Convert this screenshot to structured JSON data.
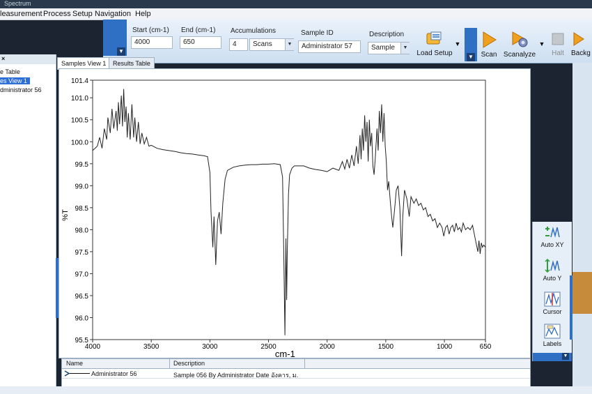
{
  "window": {
    "title": "Spectrum"
  },
  "menu": [
    "leasurement",
    "Process",
    "Setup",
    "Navigation",
    "Help"
  ],
  "toolbar": {
    "start": {
      "label": "Start (cm-1)",
      "value": "4000"
    },
    "end": {
      "label": "End (cm-1)",
      "value": "650"
    },
    "accumulations": {
      "label": "Accumulations",
      "value": "4",
      "unit": "Scans"
    },
    "sample_id": {
      "label": "Sample ID",
      "value": "Administrator 57"
    },
    "description": {
      "label": "Description",
      "value": "Sample"
    },
    "buttons": {
      "load_setup": "Load Setup",
      "scan": "Scan",
      "scanalyze": "Scanalyze",
      "halt": "Halt",
      "background": "Backg"
    }
  },
  "left_panel": {
    "items": [
      {
        "label": "e Table",
        "selected": false
      },
      {
        "label": "es View 1",
        "selected": true
      },
      {
        "label": "dministrator 56",
        "selected": false
      }
    ]
  },
  "tabs": [
    {
      "label": "Samples View 1",
      "active": true
    },
    {
      "label": "Results Table",
      "active": false
    }
  ],
  "right_panel": {
    "buttons": [
      "Auto XY",
      "Auto Y",
      "Cursor",
      "Labels"
    ]
  },
  "results_table": {
    "columns": [
      "Name",
      "Description"
    ],
    "rows": [
      {
        "name": "Administrator 56",
        "description": "Sample 056 By Administrator Date อังคาร, ม."
      }
    ]
  },
  "colors": {
    "accent": "#2f6fc4",
    "scan": "#f0a020",
    "trace": "#222222"
  },
  "chart_data": {
    "type": "line",
    "xlabel": "cm-1",
    "ylabel": "%T",
    "xlim": [
      4000,
      650
    ],
    "ylim": [
      95.5,
      101.4
    ],
    "x_reversed": true,
    "xticks": [
      4000,
      3500,
      3000,
      2500,
      2000,
      1500,
      1000,
      650
    ],
    "yticks": [
      95.5,
      96.0,
      96.5,
      97.0,
      97.5,
      98.0,
      98.5,
      99.0,
      99.5,
      100.0,
      100.5,
      101.0,
      101.4
    ],
    "ytick_labels": [
      "95.5",
      "96.0",
      "96.5",
      "97.0",
      "97.5",
      "98.0",
      "98.5",
      "99.0",
      "99.5",
      "100.0",
      "100.5",
      "101.0",
      "101.4"
    ],
    "series": [
      {
        "values_xy": [
          [
            4000,
            99.8
          ],
          [
            3960,
            99.9
          ],
          [
            3940,
            100.1
          ],
          [
            3920,
            99.85
          ],
          [
            3900,
            100.3
          ],
          [
            3880,
            100.05
          ],
          [
            3870,
            100.55
          ],
          [
            3850,
            100.2
          ],
          [
            3835,
            100.75
          ],
          [
            3820,
            100.3
          ],
          [
            3800,
            100.7
          ],
          [
            3790,
            100.25
          ],
          [
            3780,
            100.9
          ],
          [
            3770,
            100.4
          ],
          [
            3755,
            101.05
          ],
          [
            3745,
            100.35
          ],
          [
            3735,
            101.2
          ],
          [
            3725,
            100.45
          ],
          [
            3715,
            100.8
          ],
          [
            3705,
            100.1
          ],
          [
            3695,
            100.65
          ],
          [
            3680,
            100.05
          ],
          [
            3665,
            100.85
          ],
          [
            3650,
            100.1
          ],
          [
            3640,
            100.55
          ],
          [
            3625,
            100.0
          ],
          [
            3610,
            100.45
          ],
          [
            3595,
            99.95
          ],
          [
            3580,
            100.2
          ],
          [
            3560,
            99.95
          ],
          [
            3540,
            100.1
          ],
          [
            3520,
            99.9
          ],
          [
            3500,
            99.92
          ],
          [
            3450,
            99.85
          ],
          [
            3400,
            99.82
          ],
          [
            3350,
            99.8
          ],
          [
            3300,
            99.78
          ],
          [
            3250,
            99.75
          ],
          [
            3200,
            99.73
          ],
          [
            3150,
            99.72
          ],
          [
            3100,
            99.7
          ],
          [
            3050,
            99.68
          ],
          [
            3020,
            99.66
          ],
          [
            3000,
            99.3
          ],
          [
            2990,
            98.4
          ],
          [
            2975,
            97.6
          ],
          [
            2965,
            98.3
          ],
          [
            2950,
            97.2
          ],
          [
            2935,
            98.2
          ],
          [
            2920,
            98.4
          ],
          [
            2905,
            97.9
          ],
          [
            2890,
            98.6
          ],
          [
            2870,
            99.15
          ],
          [
            2850,
            99.35
          ],
          [
            2800,
            99.42
          ],
          [
            2750,
            99.45
          ],
          [
            2700,
            99.47
          ],
          [
            2650,
            99.48
          ],
          [
            2600,
            99.48
          ],
          [
            2550,
            99.49
          ],
          [
            2500,
            99.49
          ],
          [
            2450,
            99.5
          ],
          [
            2400,
            99.48
          ],
          [
            2380,
            99.2
          ],
          [
            2370,
            97.5
          ],
          [
            2360,
            95.6
          ],
          [
            2352,
            97.8
          ],
          [
            2345,
            96.4
          ],
          [
            2340,
            97.5
          ],
          [
            2330,
            98.8
          ],
          [
            2320,
            99.25
          ],
          [
            2300,
            99.4
          ],
          [
            2280,
            99.45
          ],
          [
            2200,
            99.45
          ],
          [
            2150,
            99.4
          ],
          [
            2100,
            99.37
          ],
          [
            2050,
            99.35
          ],
          [
            2000,
            99.32
          ],
          [
            1950,
            99.4
          ],
          [
            1900,
            99.35
          ],
          [
            1870,
            99.55
          ],
          [
            1850,
            99.38
          ],
          [
            1830,
            99.6
          ],
          [
            1810,
            99.4
          ],
          [
            1790,
            99.7
          ],
          [
            1770,
            99.45
          ],
          [
            1750,
            99.9
          ],
          [
            1735,
            99.5
          ],
          [
            1720,
            100.15
          ],
          [
            1710,
            99.6
          ],
          [
            1700,
            100.3
          ],
          [
            1690,
            99.8
          ],
          [
            1680,
            100.6
          ],
          [
            1670,
            100.0
          ],
          [
            1660,
            100.45
          ],
          [
            1650,
            99.55
          ],
          [
            1640,
            100.5
          ],
          [
            1630,
            99.9
          ],
          [
            1620,
            100.2
          ],
          [
            1610,
            99.45
          ],
          [
            1600,
            99.25
          ],
          [
            1590,
            99.6
          ],
          [
            1575,
            100.3
          ],
          [
            1565,
            99.8
          ],
          [
            1555,
            100.7
          ],
          [
            1545,
            100.2
          ],
          [
            1535,
            100.85
          ],
          [
            1525,
            100.0
          ],
          [
            1515,
            100.65
          ],
          [
            1505,
            99.9
          ],
          [
            1495,
            99.55
          ],
          [
            1485,
            98.9
          ],
          [
            1475,
            99.1
          ],
          [
            1460,
            98.6
          ],
          [
            1450,
            98.3
          ],
          [
            1440,
            98.05
          ],
          [
            1425,
            98.45
          ],
          [
            1410,
            98.9
          ],
          [
            1395,
            99.0
          ],
          [
            1380,
            98.5
          ],
          [
            1365,
            97.4
          ],
          [
            1355,
            98.3
          ],
          [
            1340,
            98.9
          ],
          [
            1320,
            98.7
          ],
          [
            1300,
            98.3
          ],
          [
            1285,
            98.75
          ],
          [
            1260,
            98.6
          ],
          [
            1240,
            98.7
          ],
          [
            1220,
            98.55
          ],
          [
            1200,
            98.6
          ],
          [
            1180,
            98.45
          ],
          [
            1160,
            98.5
          ],
          [
            1140,
            98.3
          ],
          [
            1120,
            98.35
          ],
          [
            1100,
            98.2
          ],
          [
            1080,
            98.25
          ],
          [
            1060,
            98.05
          ],
          [
            1040,
            98.15
          ],
          [
            1020,
            98.05
          ],
          [
            1005,
            97.85
          ],
          [
            990,
            98.05
          ],
          [
            975,
            98.1
          ],
          [
            960,
            97.9
          ],
          [
            945,
            98.05
          ],
          [
            930,
            98.1
          ],
          [
            915,
            97.95
          ],
          [
            900,
            98.15
          ],
          [
            885,
            98.0
          ],
          [
            870,
            98.05
          ],
          [
            855,
            97.95
          ],
          [
            840,
            98.15
          ],
          [
            820,
            98.0
          ],
          [
            800,
            98.05
          ],
          [
            780,
            98.0
          ],
          [
            760,
            98.1
          ],
          [
            745,
            97.9
          ],
          [
            730,
            97.7
          ],
          [
            715,
            97.5
          ],
          [
            705,
            97.75
          ],
          [
            695,
            97.45
          ],
          [
            685,
            97.7
          ],
          [
            675,
            97.6
          ],
          [
            665,
            97.65
          ],
          [
            650,
            97.6
          ]
        ]
      }
    ]
  }
}
